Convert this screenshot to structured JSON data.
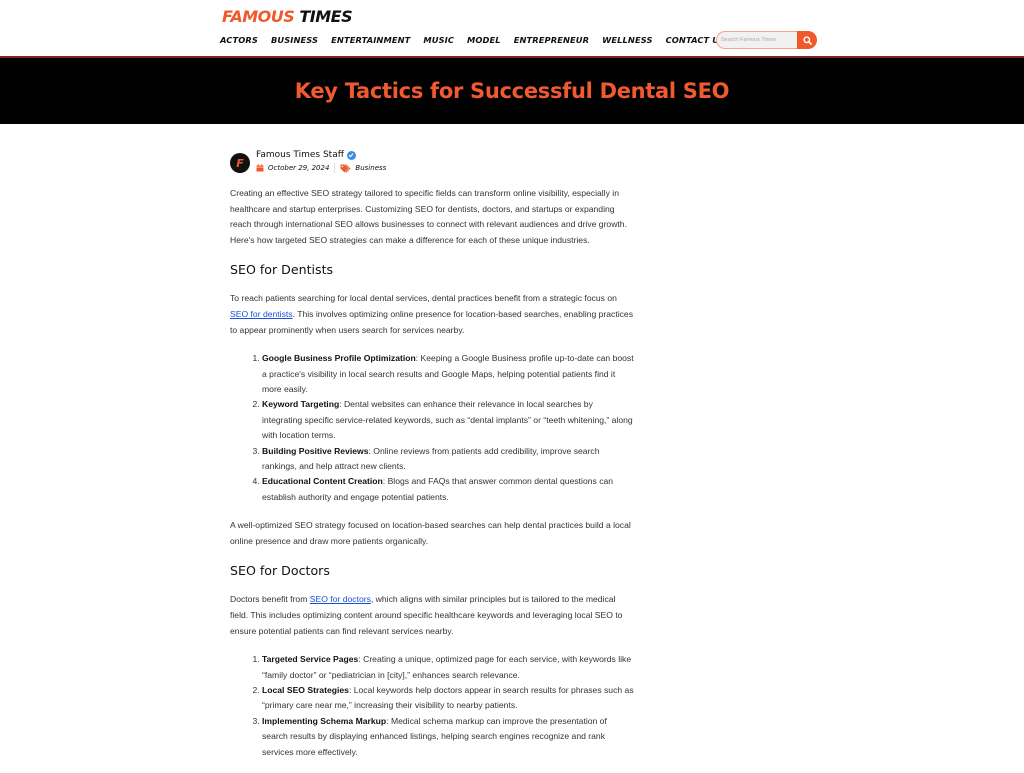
{
  "site": {
    "logo_part1": "FAMOUS",
    "logo_part2": "TIMES",
    "nav": [
      "ACTORS",
      "BUSINESS",
      "ENTERTAINMENT",
      "MUSIC",
      "MODEL",
      "ENTREPRENEUR",
      "WELLNESS",
      "CONTACT US"
    ],
    "search_placeholder": "Search Famous Times",
    "search_icon": "search-icon",
    "brand_color": "#f05a2a"
  },
  "hero": {
    "title": "Key Tactics for Successful Dental SEO"
  },
  "byline": {
    "avatar_letter": "F",
    "author": "Famous Times Staff",
    "verified_icon": "verified-check-icon",
    "date": "October 29, 2024",
    "category": "Business"
  },
  "article": {
    "intro": "Creating an effective SEO strategy tailored to specific fields can transform online visibility, especially in healthcare and startup enterprises. Customizing SEO for dentists, doctors, and startups or expanding reach through international SEO allows businesses to connect with relevant audiences and drive growth. Here's how targeted SEO strategies can make a difference for each of these unique industries.",
    "sections": [
      {
        "heading": "SEO for Dentists",
        "p_before": "To reach patients searching for local dental services, dental practices benefit from a strategic focus on ",
        "link": "SEO for dentists",
        "p_after": ". This involves optimizing online presence for location-based searches, enabling practices to appear prominently when users search for services nearby.",
        "items": [
          {
            "title": "Google Business Profile Optimization",
            "text": ": Keeping a Google Business profile up-to-date can boost a practice's visibility in local search results and Google Maps, helping potential patients find it more easily."
          },
          {
            "title": "Keyword Targeting",
            "text": ": Dental websites can enhance their relevance in local searches by integrating specific service-related keywords, such as “dental implants” or “teeth whitening,” along with location terms."
          },
          {
            "title": "Building Positive Reviews",
            "text": ": Online reviews from patients add credibility, improve search rankings, and help attract new clients."
          },
          {
            "title": "Educational Content Creation",
            "text": ": Blogs and FAQs that answer common dental questions can establish authority and engage potential patients."
          }
        ],
        "closing": "A well-optimized SEO strategy focused on location-based searches can help dental practices build a local online presence and draw more patients organically."
      },
      {
        "heading": "SEO for Doctors",
        "p_before": "Doctors benefit from ",
        "link": "SEO for doctors",
        "p_after": ", which aligns with similar principles but is tailored to the medical field. This includes optimizing content around specific healthcare keywords and leveraging local SEO to ensure potential patients can find relevant services nearby.",
        "items": [
          {
            "title": "Targeted Service Pages",
            "text": ": Creating a unique, optimized page for each service, with keywords like “family doctor” or “pediatrician in [city],” enhances search relevance."
          },
          {
            "title": "Local SEO Strategies",
            "text": ": Local keywords help doctors appear in search results for phrases such as “primary care near me,” increasing their visibility to nearby patients."
          },
          {
            "title": "Implementing Schema Markup",
            "text": ": Medical schema markup can improve the presentation of search results by displaying enhanced listings, helping search engines recognize and rank services more effectively."
          }
        ]
      }
    ]
  }
}
